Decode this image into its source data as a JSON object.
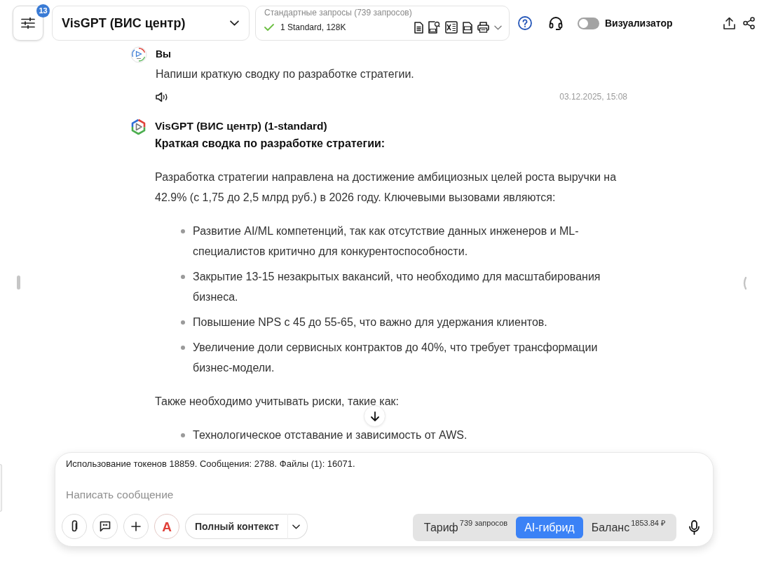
{
  "toolbar": {
    "settings_badge": "13",
    "model": "VisGPT (ВИС центр)",
    "requests": {
      "title": "Стандартные запросы (739 запросов)",
      "model": "1 Standard, 128K"
    },
    "visualizer": {
      "label": "Визуализатор",
      "on": false
    }
  },
  "messages": [
    {
      "kind": "user",
      "author": "Вы",
      "text": "Напиши краткую сводку по разработке стратегии.",
      "time": "03.12.2025, 15:08"
    },
    {
      "kind": "assistant",
      "author": "VisGPT (ВИС центр) (1-standard)",
      "blocks": [
        {
          "kind": "heading",
          "text": "Краткая сводка по разработке стратегии:"
        },
        {
          "kind": "paragraph",
          "text": "Разработка стратегии направлена на достижение амбициозных целей роста выручки на 42.9% (с 1,75 до 2,5 млрд руб.) в 2026 году. Ключевыми вызовами являются:"
        },
        {
          "kind": "list",
          "items": [
            "Развитие AI/ML компетенций, так как отсутствие данных инженеров и ML-специалистов критично для конкурентоспособности.",
            "Закрытие 13-15 незакрытых вакансий, что необходимо для масштабирования бизнеса.",
            "Повышение NPS с 45 до 55-65, что важно для удержания клиентов.",
            "Увеличение доли сервисных контрактов до 40%, что требует трансформации бизнес-модели."
          ]
        },
        {
          "kind": "paragraph",
          "text": "Также необходимо учитывать риски, такие как:"
        },
        {
          "kind": "list",
          "items": [
            "Технологическое отставание и зависимость от AWS."
          ]
        }
      ]
    }
  ],
  "composer": {
    "usage": "Использование токенов 18859. Сообщения: 2788. Файлы (1): 16071.",
    "placeholder": "Написать сообщение",
    "assistant_button": "A",
    "context": "Полный контекст",
    "modes": [
      {
        "label": "Тариф$^{739 запросов}$",
        "selected": false
      },
      {
        "label": "AI-гибрид",
        "selected": true
      },
      {
        "label": "Баланс$^{1853.84 ₽}$",
        "selected": false
      }
    ]
  }
}
